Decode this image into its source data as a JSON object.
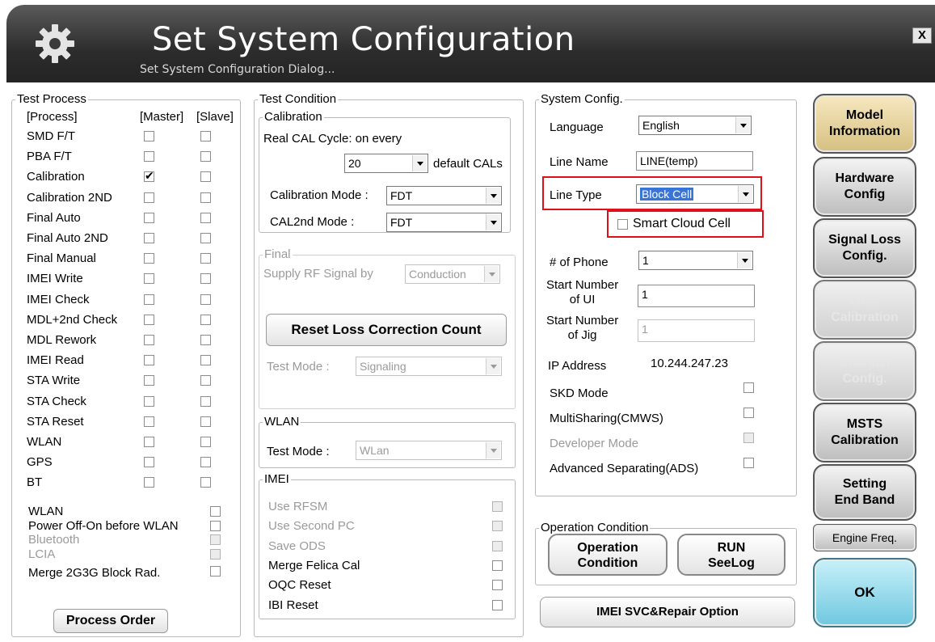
{
  "window": {
    "title": "Set System Configuration",
    "subtitle": "Set System Configuration Dialog...",
    "close_label": "X"
  },
  "test_process": {
    "legend": "Test Process",
    "col_process": "[Process]",
    "col_master": "[Master]",
    "col_slave": "[Slave]",
    "rows": [
      {
        "label": "SMD F/T",
        "master": false,
        "slave": false
      },
      {
        "label": "PBA F/T",
        "master": false,
        "slave": false
      },
      {
        "label": "Calibration",
        "master": true,
        "slave": false
      },
      {
        "label": "Calibration 2ND",
        "master": false,
        "slave": false
      },
      {
        "label": "Final Auto",
        "master": false,
        "slave": false
      },
      {
        "label": "Final Auto 2ND",
        "master": false,
        "slave": false
      },
      {
        "label": "Final Manual",
        "master": false,
        "slave": false
      },
      {
        "label": "IMEI Write",
        "master": false,
        "slave": false
      },
      {
        "label": "IMEI Check",
        "master": false,
        "slave": false
      },
      {
        "label": "MDL+2nd Check",
        "master": false,
        "slave": false
      },
      {
        "label": "MDL Rework",
        "master": false,
        "slave": false
      },
      {
        "label": "IMEI Read",
        "master": false,
        "slave": false
      },
      {
        "label": "STA Write",
        "master": false,
        "slave": false
      },
      {
        "label": "STA Check",
        "master": false,
        "slave": false
      },
      {
        "label": "STA Reset",
        "master": false,
        "slave": false
      },
      {
        "label": "WLAN",
        "master": false,
        "slave": false
      },
      {
        "label": "GPS",
        "master": false,
        "slave": false
      },
      {
        "label": "BT",
        "master": false,
        "slave": false
      }
    ],
    "options": [
      {
        "label": "WLAN",
        "disabled": false
      },
      {
        "label": "Power Off-On before WLAN",
        "disabled": false
      },
      {
        "label": "Bluetooth",
        "disabled": true
      },
      {
        "label": "LCIA",
        "disabled": true
      },
      {
        "label": "Merge 2G3G Block Rad.",
        "disabled": false
      }
    ],
    "process_order_label": "Process Order"
  },
  "test_condition": {
    "legend": "Test Condition",
    "calibration": {
      "legend": "Calibration",
      "cycle_label": "Real CAL Cycle: on every",
      "cycle_value": "20",
      "cycle_suffix": "default CALs",
      "mode_label": "Calibration Mode :",
      "mode_value": "FDT",
      "cal2nd_label": "CAL2nd Mode :",
      "cal2nd_value": "FDT"
    },
    "final": {
      "legend": "Final",
      "supply_label": "Supply RF Signal by",
      "supply_value": "Conduction",
      "reset_button": "Reset Loss Correction Count",
      "test_mode_label": "Test Mode :",
      "test_mode_value": "Signaling"
    },
    "wlan": {
      "legend": "WLAN",
      "test_mode_label": "Test Mode :",
      "test_mode_value": "WLan"
    },
    "imei": {
      "legend": "IMEI",
      "items": [
        {
          "label": "Use RFSM",
          "disabled": true
        },
        {
          "label": "Use Second PC",
          "disabled": true
        },
        {
          "label": "Save ODS",
          "disabled": true
        },
        {
          "label": "Merge Felica Cal",
          "disabled": false
        },
        {
          "label": "OQC Reset",
          "disabled": false
        },
        {
          "label": "IBI Reset",
          "disabled": false
        }
      ]
    }
  },
  "system_config": {
    "legend": "System Config.",
    "language_label": "Language",
    "language_value": "English",
    "line_name_label": "Line Name",
    "line_name_value": "LINE(temp)",
    "line_type_label": "Line Type",
    "line_type_value": "Block Cell",
    "smart_cloud_label": "Smart Cloud Cell",
    "phones_label": "# of Phone",
    "phones_value": "1",
    "start_ui_label_1": "Start Number",
    "start_ui_label_2": "of UI",
    "start_ui_value": "1",
    "start_jig_label_1": "Start Number",
    "start_jig_label_2": "of Jig",
    "start_jig_value": "1",
    "ip_label": "IP Address",
    "ip_value": "10.244.247.23",
    "flags": [
      {
        "label": "SKD Mode",
        "disabled": false
      },
      {
        "label": "MultiSharing(CMWS)",
        "disabled": false
      },
      {
        "label": "Developer Mode",
        "disabled": true
      },
      {
        "label": "Advanced Separating(ADS)",
        "disabled": false
      }
    ]
  },
  "operation_condition": {
    "legend": "Operation Condition",
    "operation_btn_1": "Operation",
    "operation_btn_2": "Condition",
    "run_btn_1": "RUN",
    "run_btn_2": "SeeLog",
    "imei_svc_label": "IMEI SVC&Repair Option"
  },
  "side_buttons": {
    "model_1": "Model",
    "model_2": "Information",
    "hardware_1": "Hardware",
    "hardware_2": "Config",
    "signal_1": "Signal Loss",
    "signal_2": "Config.",
    "loss_1": "Loss",
    "loss_2": "Calibration",
    "channel_1": "Channel",
    "channel_2": "Config.",
    "msts_1": "MSTS",
    "msts_2": "Calibration",
    "setting_1": "Setting",
    "setting_2": "End Band",
    "engine": "Engine Freq.",
    "ok": "OK"
  }
}
